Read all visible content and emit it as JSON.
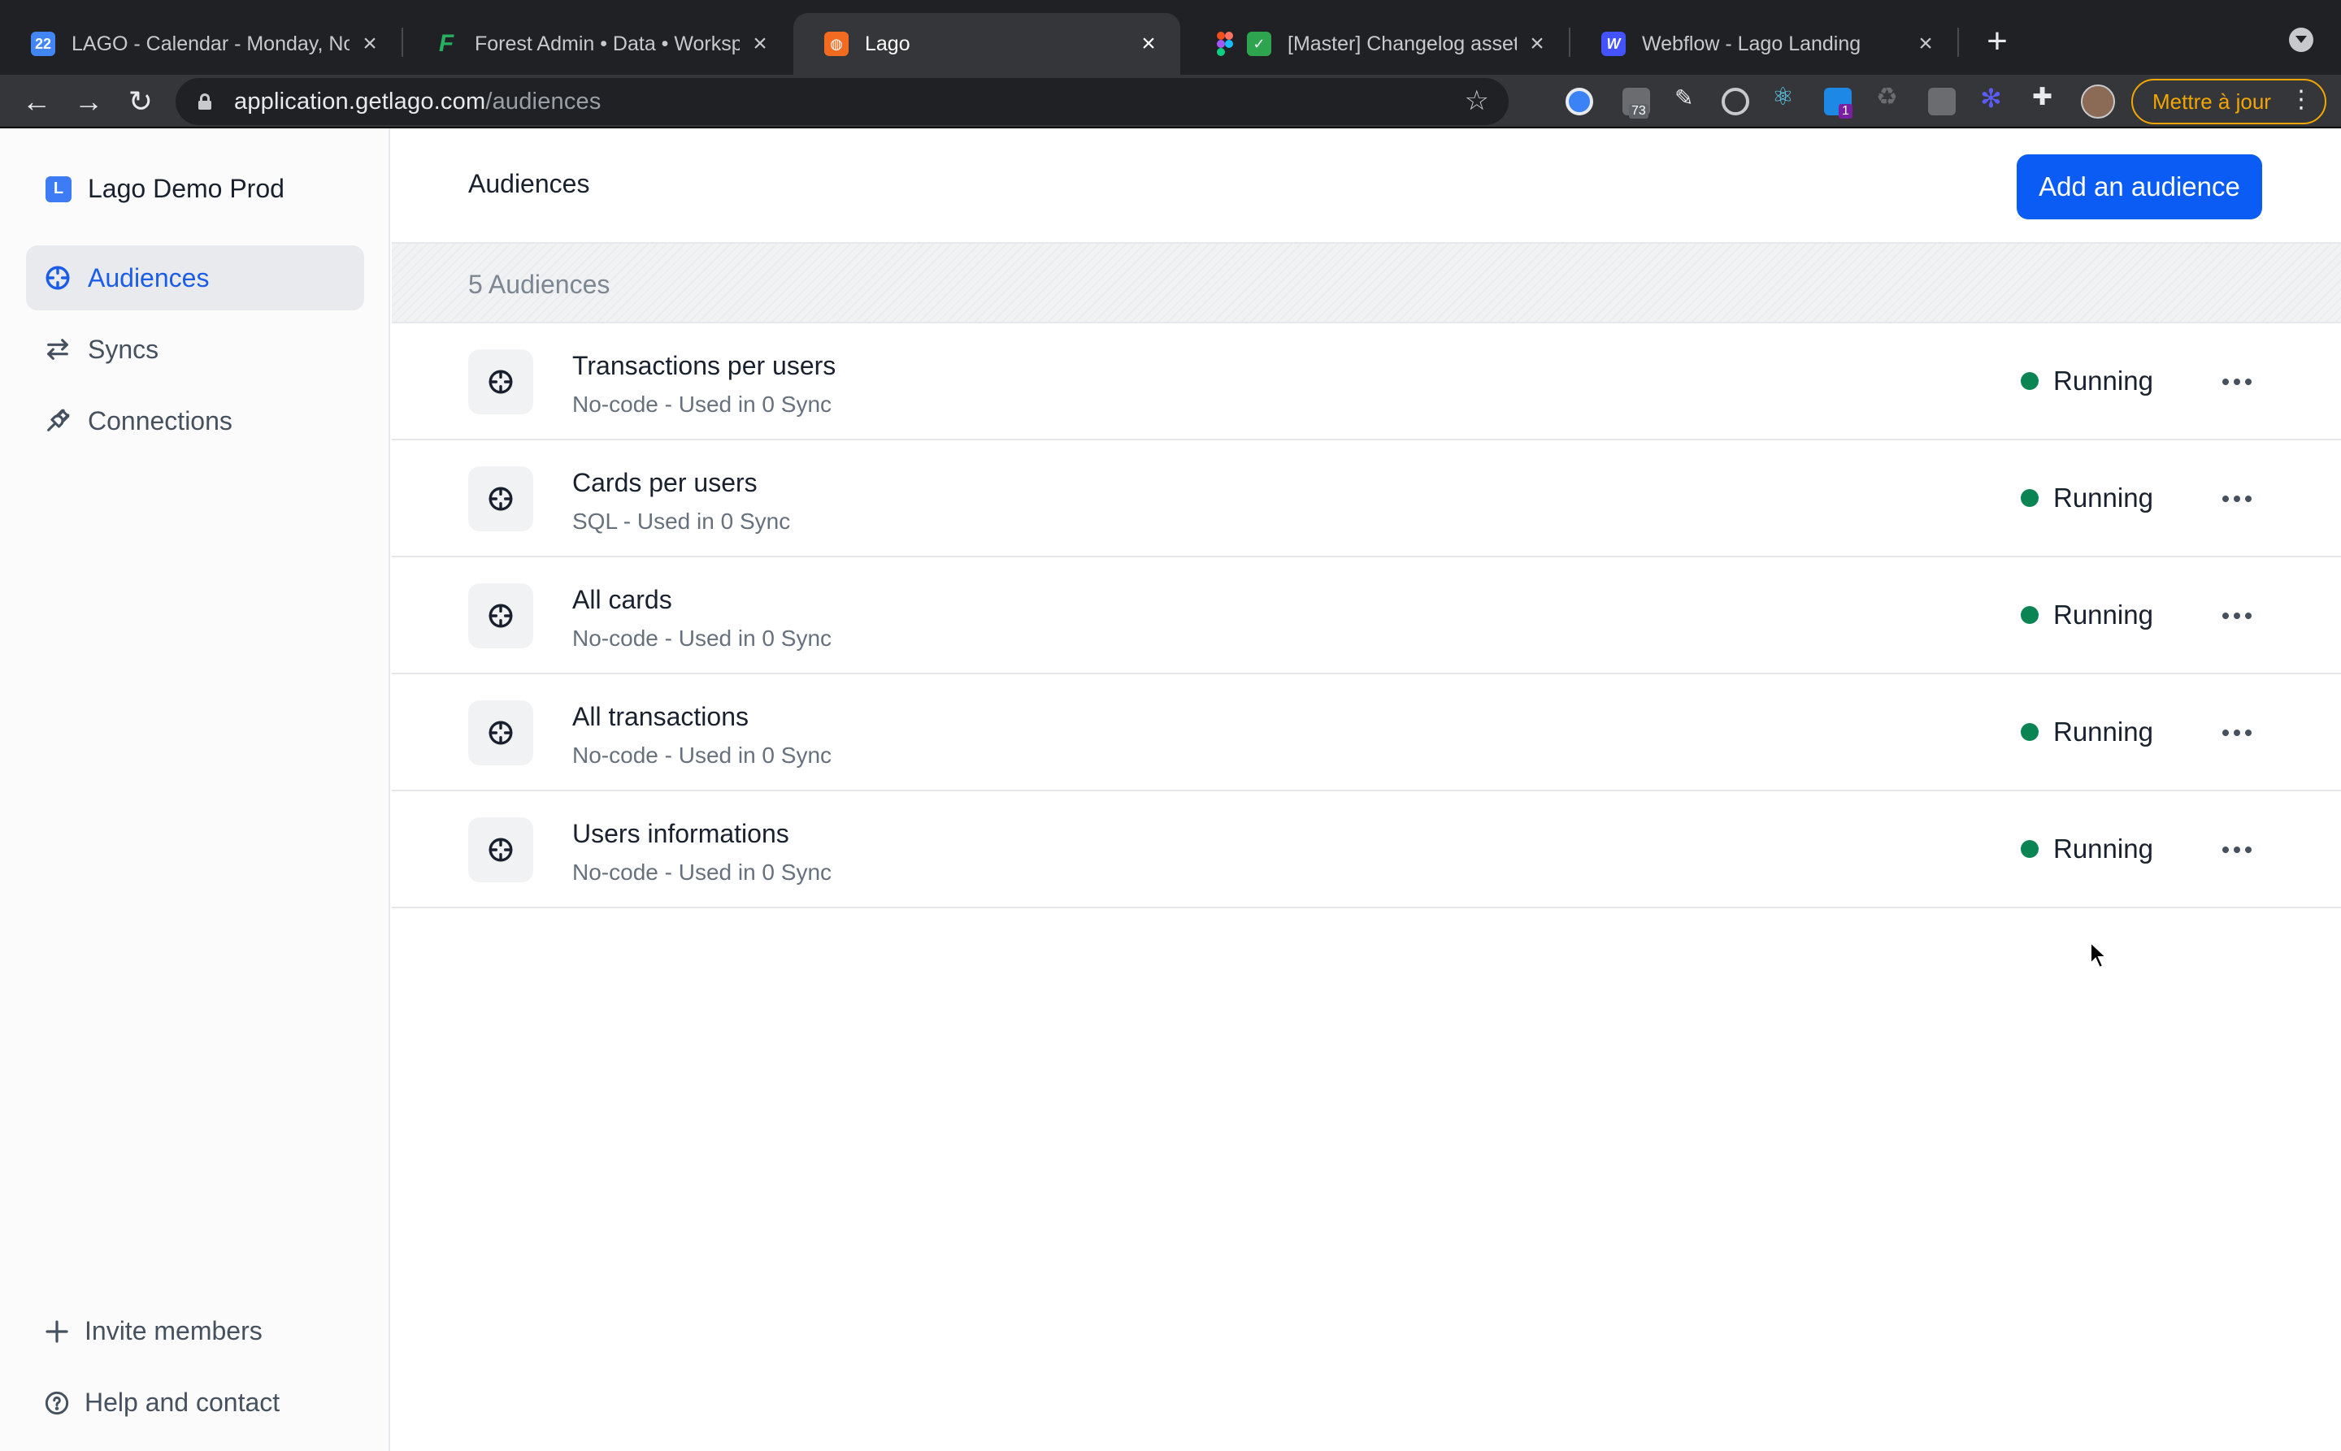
{
  "browser": {
    "tabs": [
      {
        "title": "LAGO - Calendar - Monday, No",
        "favicon": "calendar-icon",
        "color": "#4285f4"
      },
      {
        "title": "Forest Admin • Data • Workspa",
        "favicon": "forest-admin-icon",
        "color": "#27ae60"
      },
      {
        "title": "Lago",
        "favicon": "lago-icon",
        "color": "#f26b21",
        "active": true
      },
      {
        "title": "[Master] Changelog assets",
        "favicon": "figma-icon",
        "color": "#f24e1e"
      },
      {
        "title": "Webflow - Lago Landing",
        "favicon": "webflow-icon",
        "color": "#4353ff"
      }
    ],
    "url_host": "application.getlago.com",
    "url_path": "/audiences",
    "update_label": "Mettre à jour",
    "extension_badge": "73",
    "extension_badge_2": "1"
  },
  "sidebar": {
    "workspace_initial": "L",
    "workspace_name": "Lago Demo Prod",
    "items": [
      {
        "label": "Audiences",
        "icon": "crosshair-icon",
        "active": true
      },
      {
        "label": "Syncs",
        "icon": "arrows-swap-icon"
      },
      {
        "label": "Connections",
        "icon": "plug-icon"
      }
    ],
    "bottom": [
      {
        "label": "Invite members",
        "icon": "plus-icon"
      },
      {
        "label": "Help and contact",
        "icon": "help-circle-icon"
      }
    ]
  },
  "main": {
    "title": "Audiences",
    "add_button": "Add an audience",
    "count_label": "5 Audiences",
    "audiences": [
      {
        "name": "Transactions per users",
        "meta": "No-code - Used in 0 Sync",
        "status": "Running"
      },
      {
        "name": "Cards per users",
        "meta": "SQL - Used in 0 Sync",
        "status": "Running"
      },
      {
        "name": "All cards",
        "meta": "No-code - Used in 0 Sync",
        "status": "Running"
      },
      {
        "name": "All transactions",
        "meta": "No-code - Used in 0 Sync",
        "status": "Running"
      },
      {
        "name": "Users informations",
        "meta": "No-code - Used in 0 Sync",
        "status": "Running"
      }
    ]
  },
  "colors": {
    "accent": "#0a5cf5",
    "running": "#0b8454",
    "update": "#f2a600"
  }
}
